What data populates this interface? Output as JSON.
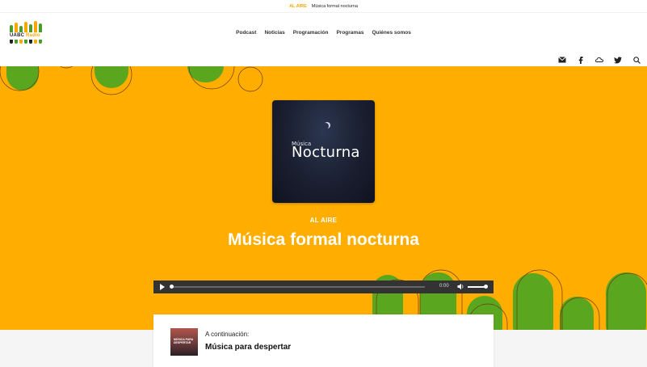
{
  "ticker": {
    "tag": "AL AIRE",
    "title": "Música formal nocturna"
  },
  "header": {
    "logo": {
      "text_main": "UABC",
      "text_accent": "Radio"
    },
    "nav": [
      "Podcast",
      "Noticias",
      "Programación",
      "Programas",
      "Quiénes somos"
    ]
  },
  "icons": [
    "mail-icon",
    "facebook-icon",
    "soundcloud-icon",
    "twitter-icon",
    "search-icon"
  ],
  "hero": {
    "cover": {
      "small": "Música",
      "big": "Nocturna"
    },
    "onair": "AL AIRE",
    "title": "Música formal nocturna",
    "player": {
      "time": "0:00",
      "progress": 0,
      "volume": 1.0
    }
  },
  "next": {
    "label": "A continuación:",
    "title": "Música para despertar",
    "thumb_text": "MÚSICA PARA DESPERTAR"
  },
  "colors": {
    "accent": "#ffae00",
    "green": "#5aa61e",
    "player": "#333333"
  }
}
